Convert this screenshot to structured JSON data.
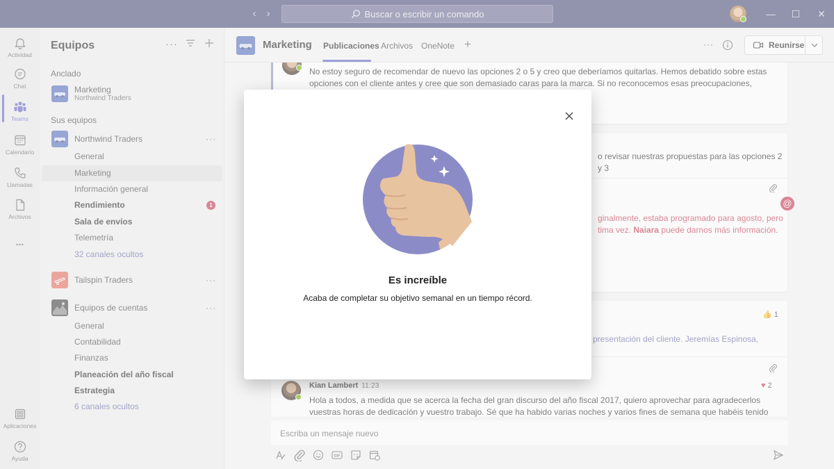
{
  "app": {
    "search_placeholder": "Buscar o escribir un comando",
    "nav_back": "‹",
    "nav_forward": "›",
    "window_controls": [
      "—",
      "☐",
      "✕"
    ]
  },
  "rail": {
    "items": [
      {
        "label": "Actividad",
        "icon": "bell-icon"
      },
      {
        "label": "Chat",
        "icon": "chat-icon"
      },
      {
        "label": "Teams",
        "icon": "teams-icon",
        "active": true
      },
      {
        "label": "Calendario",
        "icon": "calendar-icon"
      },
      {
        "label": "Llamadas",
        "icon": "phone-icon"
      },
      {
        "label": "Archivos",
        "icon": "file-icon"
      },
      {
        "label": "...",
        "icon": "more-icon"
      }
    ],
    "bottom": [
      {
        "label": "Aplicaciones",
        "icon": "apps-icon"
      },
      {
        "label": "Ayuda",
        "icon": "help-icon"
      }
    ]
  },
  "teams_panel": {
    "title": "Equipos",
    "pinned_label": "Anclado",
    "pinned": {
      "name": "Marketing",
      "sub": "Northwind Traders"
    },
    "your_teams_label": "Sus equipos",
    "teams": [
      {
        "name": "Northwind Traders",
        "channels": [
          {
            "label": "General",
            "style": "normal"
          },
          {
            "label": "Marketing",
            "style": "selected"
          },
          {
            "label": "Información general",
            "style": "normal"
          },
          {
            "label": "Rendimiento",
            "style": "bold",
            "badge": "1"
          },
          {
            "label": "Sala de envíos",
            "style": "bold"
          },
          {
            "label": "Telemetría",
            "style": "normal"
          },
          {
            "label": "32 canales ocultos",
            "style": "link"
          }
        ]
      },
      {
        "name": "Tailspin Traders",
        "channels": []
      },
      {
        "name": "Equipos de cuentas",
        "channels": [
          {
            "label": "General",
            "style": "normal"
          },
          {
            "label": "Contabilidad",
            "style": "normal"
          },
          {
            "label": "Finanzas",
            "style": "normal"
          },
          {
            "label": "Planeación del año fiscal",
            "style": "bold"
          },
          {
            "label": "Estrategia",
            "style": "bold"
          },
          {
            "label": "6 canales ocultos",
            "style": "link"
          }
        ]
      }
    ],
    "more": "···"
  },
  "channel_header": {
    "name": "Marketing",
    "tabs": [
      "Publicaciones",
      "Archivos",
      "OneNote"
    ],
    "add_tab": "+",
    "more": "···",
    "meet_label": "Reunirse"
  },
  "conversation": {
    "post1_text": "No estoy seguro de recomendar de nuevo las opciones 2 o 5 y creo que deberíamos quitarlas. Hemos debatido sobre estas opciones con el cliente antes y cree que son demasiado caras para la marca. Si no reconocemos esas preocupaciones,",
    "post2_text": "o revisar nuestras propuestas para las opciones 2 y 3",
    "post3_text_a": "ginalmente, estaba programado para agosto, pero",
    "post3_text_b": "tima vez.",
    "post3_mention": "Naiara",
    "post3_text_c": "puede darnos más información.",
    "post4_reaction_count": "1",
    "post4_text": "presentación del cliente. Jeremías Espinosa,",
    "post5_author": "Kian Lambert",
    "post5_time": "11:23",
    "post5_reaction_count": "2",
    "post5_text": "Hola a todos, a medida que se acerca la fecha del gran discurso del año fiscal 2017, quiero aprovechar para agradecerlos vuestras horas de dedicación y vuestro trabajo. Sé que ha habido varias noches y varios fines de semana que habéis tenido que trabajar"
  },
  "composer": {
    "placeholder": "Escriba un mensaje nuevo"
  },
  "dialog": {
    "title": "Es increíble",
    "message": "Acaba de completar su objetivo semanal en un tiempo récord.",
    "close_label": "✕"
  },
  "colors": {
    "titlebar": "#464775",
    "accent": "#5b5fc7",
    "illustration_circle": "#8b8cc7",
    "hand": "#e8c3a0",
    "mention": "#c4314b"
  }
}
